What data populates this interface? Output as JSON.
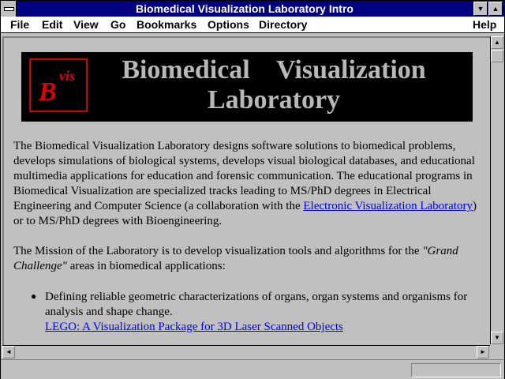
{
  "window": {
    "title": "Biomedical Visualization Laboratory Intro"
  },
  "menubar": {
    "items": [
      "File",
      "Edit",
      "View",
      "Go",
      "Bookmarks",
      "Options",
      "Directory"
    ],
    "help": "Help"
  },
  "banner": {
    "logo_letter": "B",
    "logo_sup": "vis",
    "title_line1": "Biomedical    Visualization",
    "title_line2": "Laboratory"
  },
  "content": {
    "para1_text": "The Biomedical Visualization Laboratory designs software solutions to biomedical problems, develops simulations of biological systems, develops visual biological databases, and educational multimedia applications for education and forensic communication. The educational programs in Biomedical Visualization are specialized tracks leading to MS/PhD degrees in Electrical Engineering and Computer Science (a collaboration with the ",
    "para1_link": "Electronic Visualization Laboratory",
    "para1_end": ") or to MS/PhD degrees with Bioengineering.",
    "para2_text": "The Mission of the Laboratory is to develop visualization tools and algorithms for the ",
    "para2_em": "\"Grand Challenge\"",
    "para2_end": " areas in biomedical applications:",
    "bullet1_text": "Defining reliable geometric characterizations of organs, organ systems and organisms for analysis and shape change.",
    "bullet1_link": "LEGO: A Visualization Package for 3D Laser Scanned Objects"
  }
}
